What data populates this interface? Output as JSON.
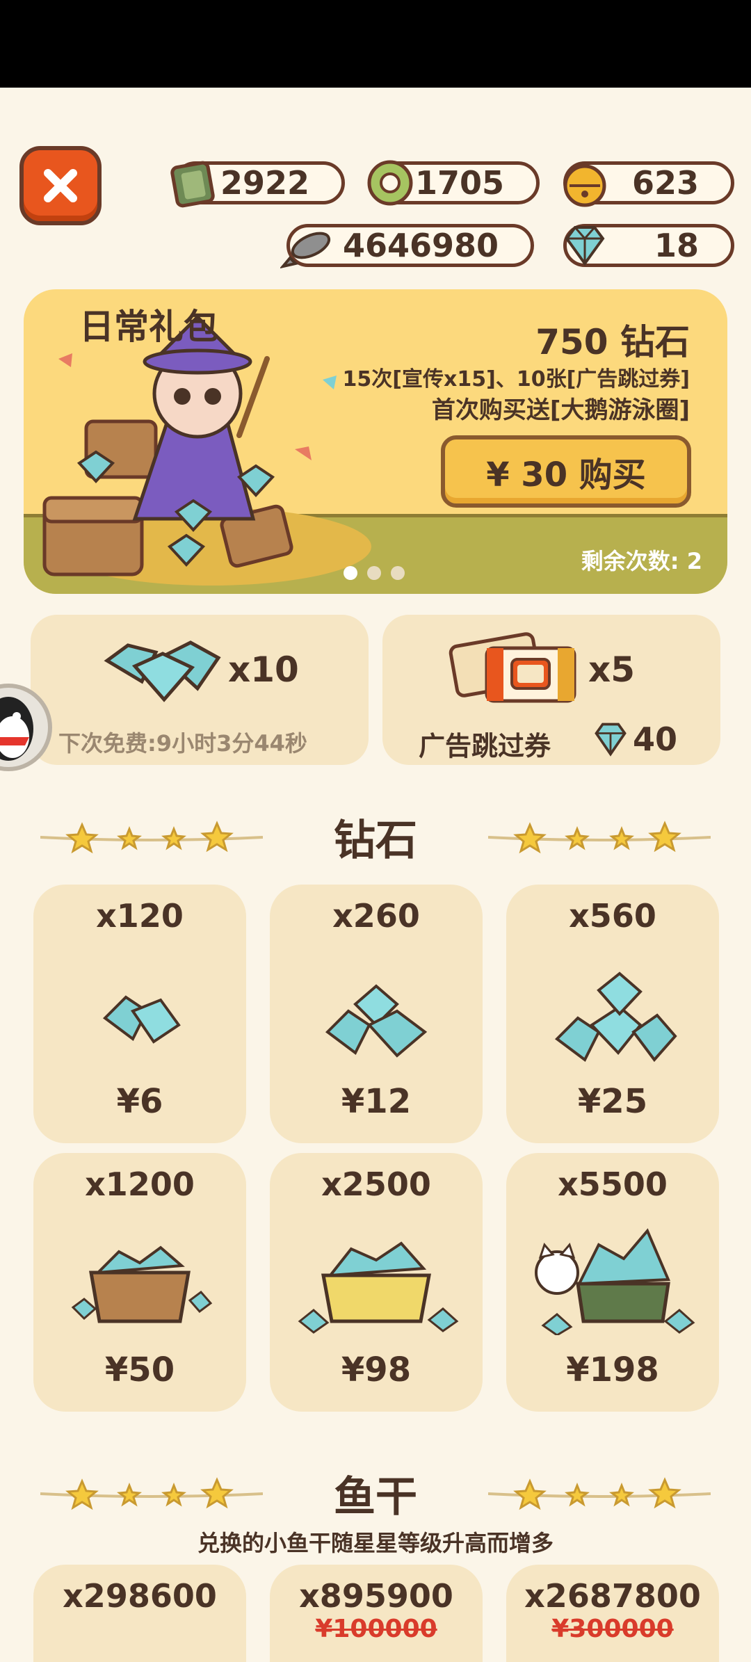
{
  "currencies": {
    "tickets": "2922",
    "coins": "1705",
    "bells": "623",
    "fish": "4646980",
    "diamonds": "18"
  },
  "banner": {
    "title": "日常礼包",
    "amount": "750 钻石",
    "line1": "15次[宣传x15]、10张[广告跳过券]",
    "line2": "首次购买送[大鹅游泳圈]",
    "buy_label": "¥ 30 购买",
    "remaining": "剩余次数: 2",
    "page_count": 3,
    "active_page": 1
  },
  "free_reward": {
    "qty": "x10",
    "next_free": "下次免费:9小时3分44秒"
  },
  "ad_skip": {
    "qty": "x5",
    "label": "广告跳过券",
    "cost": "40"
  },
  "sections": {
    "diamonds_title": "钻石",
    "fish_title": "鱼干",
    "fish_subtitle": "兑换的小鱼干随星星等级升高而增多"
  },
  "diamond_packs": [
    {
      "qty": "x120",
      "price": "¥6"
    },
    {
      "qty": "x260",
      "price": "¥12"
    },
    {
      "qty": "x560",
      "price": "¥25"
    },
    {
      "qty": "x1200",
      "price": "¥50"
    },
    {
      "qty": "x2500",
      "price": "¥98"
    },
    {
      "qty": "x5500",
      "price": "¥198"
    }
  ],
  "fish_packs": [
    {
      "qty": "x298600",
      "old": ""
    },
    {
      "qty": "x895900",
      "old": "¥100000"
    },
    {
      "qty": "x2687800",
      "old": "¥300000"
    }
  ],
  "colors": {
    "background": "#fbf5e8",
    "card": "#f6e6c4",
    "banner": "#fcd97d",
    "close": "#e8561e",
    "diamond": "#7fd0d3",
    "text": "#4a3326"
  }
}
